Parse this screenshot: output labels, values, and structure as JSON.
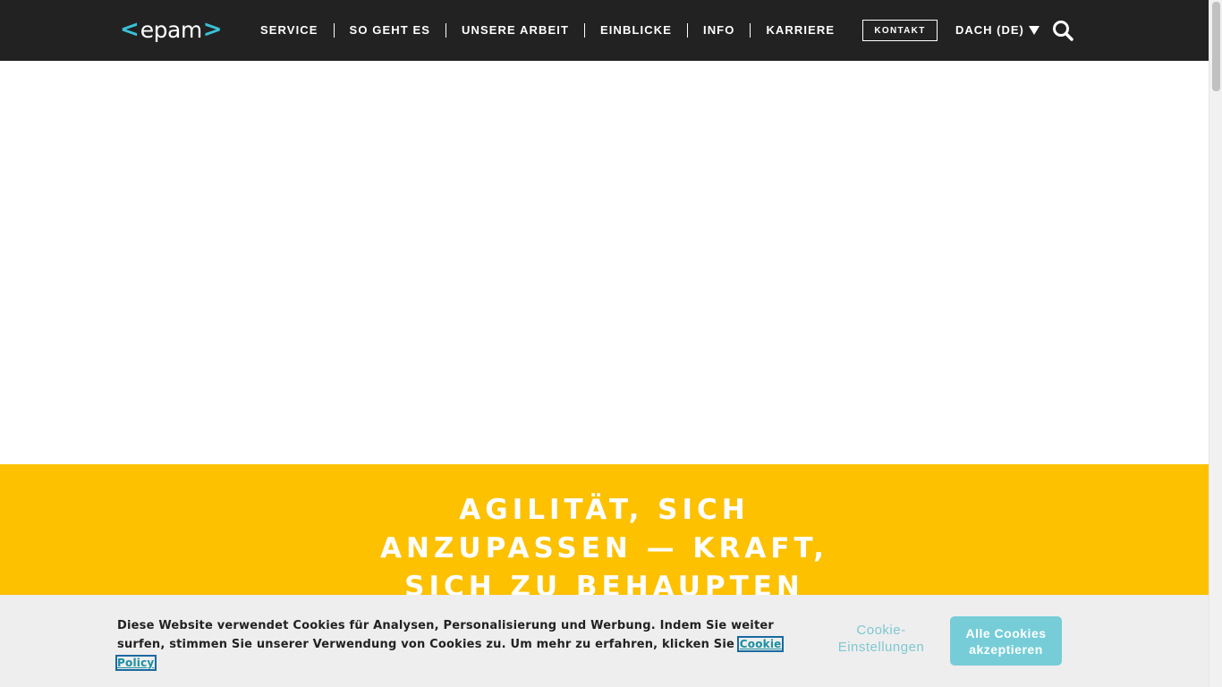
{
  "header": {
    "logo": {
      "left_bracket": "<",
      "text": "epam",
      "right_bracket": ">"
    },
    "nav": [
      {
        "label": "SERVICE"
      },
      {
        "label": "SO GEHT ES"
      },
      {
        "label": "UNSERE ARBEIT"
      },
      {
        "label": "EINBLICKE"
      },
      {
        "label": "INFO"
      },
      {
        "label": "KARRIERE"
      }
    ],
    "contact_label": "KONTAKT",
    "region_label": "DACH (DE)",
    "search_icon": "search-icon"
  },
  "hero": {
    "headline": "AGILITÄT, SICH ANZUPASSEN — KRAFT, SICH ZU BEHAUPTEN"
  },
  "cookie_banner": {
    "text": "Diese Website verwendet Cookies für Analysen, Personalisierung und Werbung. Indem Sie weiter surfen, stimmen Sie unserer Verwendung von Cookies zu. Um mehr zu erfahren, klicken Sie",
    "link_label": "Cookie Policy",
    "settings_label": "Cookie-Einstellungen",
    "accept_label": "Alle Cookies akzeptieren"
  },
  "colors": {
    "header_bg": "#222222",
    "accent_cyan": "#39c2d7",
    "banner_yellow": "#fdc100",
    "cookie_bg": "#eeeeee",
    "accept_button": "#76cdd8"
  }
}
